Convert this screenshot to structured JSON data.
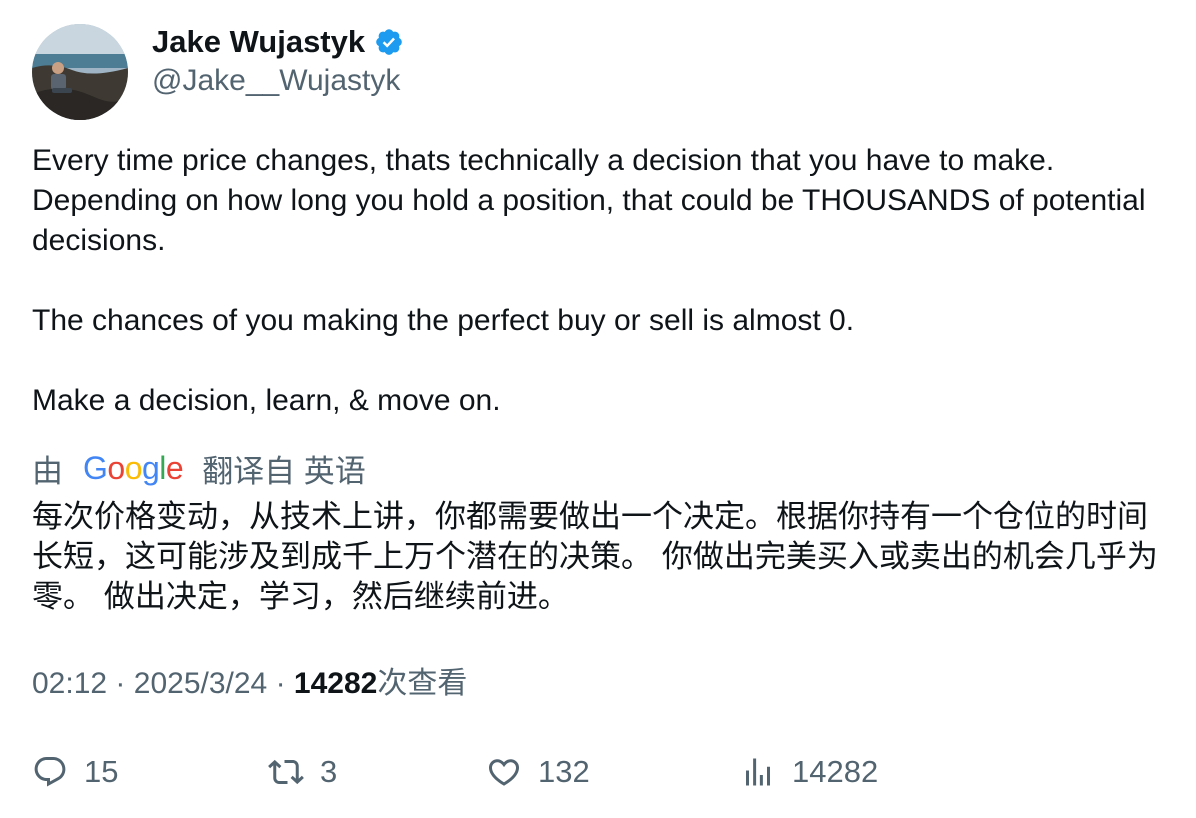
{
  "author": {
    "name": "Jake Wujastyk",
    "handle": "@Jake__Wujastyk",
    "verified": true
  },
  "tweet": {
    "paragraphs": [
      "Every time price changes, thats technically a decision that you have to make. Depending on how long you hold a position, that could be THOUSANDS of potential decisions.",
      "The chances of you making the perfect buy or sell is almost 0.",
      "Make a decision, learn, & move on."
    ]
  },
  "translation": {
    "by_prefix": "由",
    "provider_logo": [
      "G",
      "o",
      "o",
      "g",
      "l",
      "e"
    ],
    "provider_colors": [
      "#4285F4",
      "#EA4335",
      "#FBBC05",
      "#4285F4",
      "#34A853",
      "#EA4335"
    ],
    "suffix": "翻译自 英语",
    "text": "每次价格变动，从技术上讲，你都需要做出一个决定。根据你持有一个仓位的时间长短，这可能涉及到成千上万个潜在的决策。 你做出完美买入或卖出的机会几乎为零。 做出决定，学习，然后继续前进。"
  },
  "meta": {
    "time": "02:12",
    "separator": "·",
    "date": "2025/3/24",
    "views_count": "14282",
    "views_label": "次查看"
  },
  "actions": {
    "replies": "15",
    "retweets": "3",
    "likes": "132",
    "views": "14282"
  },
  "colors": {
    "text": "#0f1419",
    "secondary": "#536471",
    "verified": "#1d9bf0"
  },
  "icons": {
    "verified": "verified-badge-icon",
    "reply": "reply-icon",
    "retweet": "retweet-icon",
    "like": "heart-icon",
    "views": "analytics-bar-icon"
  }
}
